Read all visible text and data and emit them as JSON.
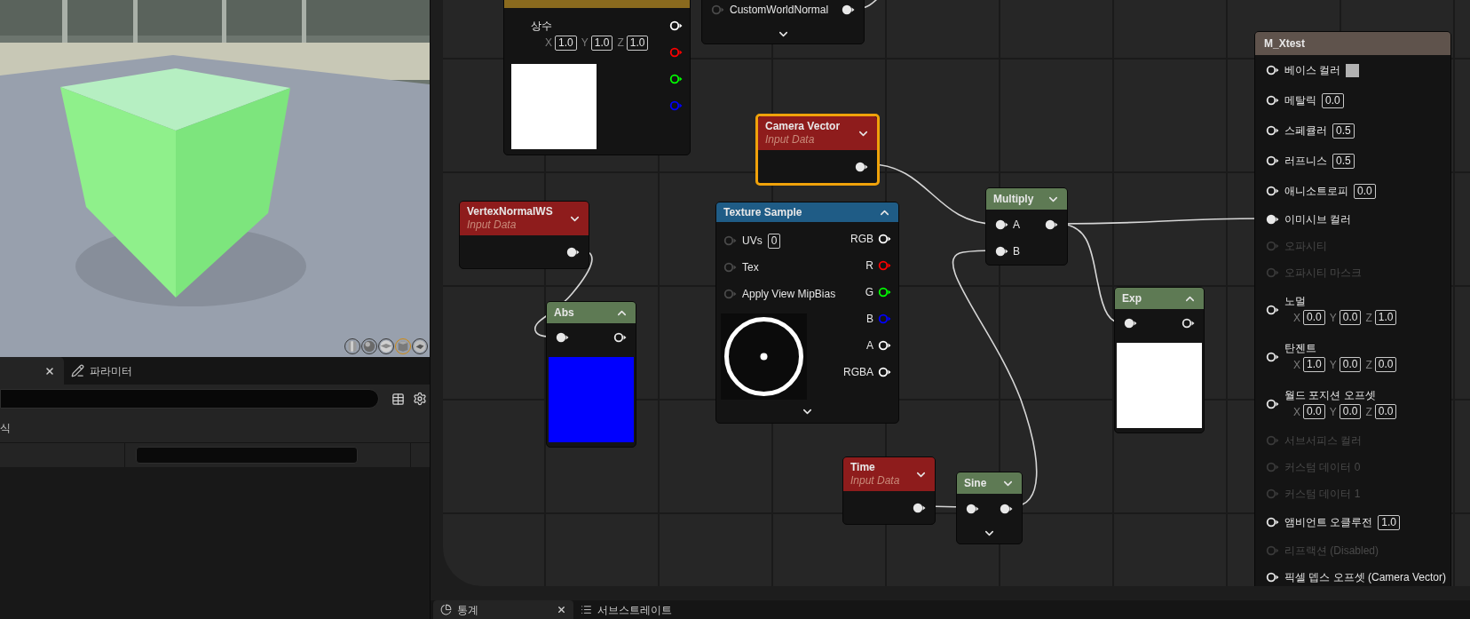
{
  "viewport": {
    "shapes": [
      {
        "kind": "cylinder",
        "selected": false
      },
      {
        "kind": "sphere",
        "selected": false
      },
      {
        "kind": "plane",
        "selected": false
      },
      {
        "kind": "cube",
        "selected": true
      },
      {
        "kind": "mesh",
        "selected": false
      }
    ]
  },
  "details": {
    "tabs": [
      {
        "selected": true,
        "closable": true
      },
      {
        "label": "파라미터",
        "selected": false,
        "closable": false
      }
    ],
    "category": "식"
  },
  "graph": {
    "nodes": [
      {
        "kind": "constant",
        "color": "#8a6a1e",
        "selected": false,
        "label": "상수",
        "fields": [
          {
            "axis": "X",
            "value": "1.0"
          },
          {
            "axis": "Y",
            "value": "1.0"
          },
          {
            "axis": "Z",
            "value": "1.0"
          }
        ],
        "outputs": [
          {
            "color": "#ffffff",
            "connected": false
          },
          {
            "color": "#ff0000",
            "connected": false
          },
          {
            "color": "#00ff00",
            "connected": false
          },
          {
            "color": "#0000ff",
            "connected": false
          }
        ],
        "preview": {
          "color": "#ffffff"
        }
      },
      {
        "kind": "row",
        "selected": false,
        "label": "CustomWorldNormal",
        "input": {
          "connected": false
        },
        "output": {
          "connected": true
        },
        "advanced": true
      },
      {
        "kind": "input",
        "color": "#8e1c1c",
        "selected": true,
        "title": "Camera Vector",
        "subtitle": "Input Data",
        "expanded": false,
        "output": {
          "connected": true
        }
      },
      {
        "kind": "input",
        "color": "#8e1c1c",
        "selected": false,
        "title": "VertexNormalWS",
        "subtitle": "Input Data",
        "expanded": false,
        "output": {
          "connected": true
        }
      },
      {
        "kind": "function",
        "color": "#5e7a54",
        "selected": false,
        "title": "Abs",
        "expanded": true,
        "input": {
          "connected": true
        },
        "output": {
          "connected": false
        },
        "preview": {
          "color": "#0000ff"
        }
      },
      {
        "kind": "texture",
        "color": "#1f5c86",
        "selected": false,
        "title": "Texture Sample",
        "expanded": true,
        "advanced": true,
        "inputs": [
          {
            "label": "UVs",
            "value": "0",
            "connected": false
          },
          {
            "label": "Tex",
            "connected": false
          },
          {
            "label": "Apply View MipBias",
            "connected": false
          }
        ],
        "outputs": [
          {
            "label": "RGB",
            "color": "#ffffff",
            "connected": false
          },
          {
            "label": "R",
            "color": "#ff0000",
            "connected": false
          },
          {
            "label": "G",
            "color": "#00ff00",
            "connected": false
          },
          {
            "label": "B",
            "color": "#0000ff",
            "connected": false
          },
          {
            "label": "A",
            "color": "#ffffff",
            "connected": false
          },
          {
            "label": "RGBA",
            "color": "#ffffff",
            "connected": false
          }
        ]
      },
      {
        "kind": "math",
        "color": "#5e7a54",
        "selected": false,
        "title": "Multiply",
        "expanded": false,
        "advanced": false,
        "inputs": [
          {
            "label": "A",
            "connected": true
          },
          {
            "label": "B",
            "connected": true
          }
        ],
        "output": {
          "connected": true
        }
      },
      {
        "kind": "function",
        "color": "#5e7a54",
        "selected": false,
        "title": "Exp",
        "expanded": true,
        "input": {
          "connected": true
        },
        "output": {
          "connected": false
        },
        "preview": {
          "color": "#ffffff"
        }
      },
      {
        "kind": "input",
        "color": "#8e1c1c",
        "selected": false,
        "title": "Time",
        "subtitle": "Input Data",
        "expanded": false,
        "output": {
          "connected": true
        }
      },
      {
        "kind": "math",
        "color": "#5e7a54",
        "selected": false,
        "title": "Sine",
        "expanded": false,
        "advanced": true,
        "inputs": [
          {
            "connected": true
          }
        ],
        "output": {
          "connected": true
        }
      }
    ],
    "result": {
      "title": "M_Xtest",
      "color": "#5f534c",
      "inputs": [
        {
          "kind": "swatch",
          "label": "베이스 컬러",
          "swatch": {
            "color": "#b3b3b3"
          },
          "connected": false,
          "disabled": false
        },
        {
          "kind": "value",
          "label": "메탈릭",
          "value": "0.0",
          "connected": false,
          "disabled": false
        },
        {
          "kind": "value",
          "label": "스페큘러",
          "value": "0.5",
          "connected": false,
          "disabled": false
        },
        {
          "kind": "value",
          "label": "러프니스",
          "value": "0.5",
          "connected": false,
          "disabled": false
        },
        {
          "kind": "value",
          "label": "애니소트로피",
          "value": "0.0",
          "connected": false,
          "disabled": false
        },
        {
          "kind": "plain",
          "label": "이미시브 컬러",
          "connected": true,
          "disabled": false
        },
        {
          "kind": "plain",
          "label": "오파시티",
          "connected": false,
          "disabled": true
        },
        {
          "kind": "plain",
          "label": "오파시티 마스크",
          "connected": false,
          "disabled": true
        },
        {
          "kind": "vector",
          "label": "노멀",
          "fields": [
            {
              "axis": "X",
              "value": "0.0"
            },
            {
              "axis": "Y",
              "value": "0.0"
            },
            {
              "axis": "Z",
              "value": "1.0"
            }
          ],
          "connected": false,
          "disabled": false
        },
        {
          "kind": "vector",
          "label": "탄젠트",
          "fields": [
            {
              "axis": "X",
              "value": "1.0"
            },
            {
              "axis": "Y",
              "value": "0.0"
            },
            {
              "axis": "Z",
              "value": "0.0"
            }
          ],
          "connected": false,
          "disabled": false
        },
        {
          "kind": "vector",
          "label": "월드 포지션 오프셋",
          "fields": [
            {
              "axis": "X",
              "value": "0.0"
            },
            {
              "axis": "Y",
              "value": "0.0"
            },
            {
              "axis": "Z",
              "value": "0.0"
            }
          ],
          "connected": false,
          "disabled": false
        },
        {
          "kind": "plain",
          "label": "서브서피스 컬러",
          "connected": false,
          "disabled": true
        },
        {
          "kind": "plain",
          "label": "커스텀 데이터 0",
          "connected": false,
          "disabled": true
        },
        {
          "kind": "plain",
          "label": "커스텀 데이터 1",
          "connected": false,
          "disabled": true
        },
        {
          "kind": "value",
          "label": "앰비언트 오클루전",
          "value": "1.0",
          "connected": false,
          "disabled": false
        },
        {
          "kind": "plain",
          "label": "리프랙션 (Disabled)",
          "connected": false,
          "disabled": true
        },
        {
          "kind": "plain",
          "label": "픽셀 뎁스 오프셋 (Camera Vector)",
          "connected": false,
          "disabled": false
        }
      ]
    }
  },
  "bottom_tabs": [
    {
      "label": "통계",
      "selected": true,
      "closable": true
    },
    {
      "label": "서브스트레이트",
      "selected": false,
      "closable": false
    }
  ]
}
